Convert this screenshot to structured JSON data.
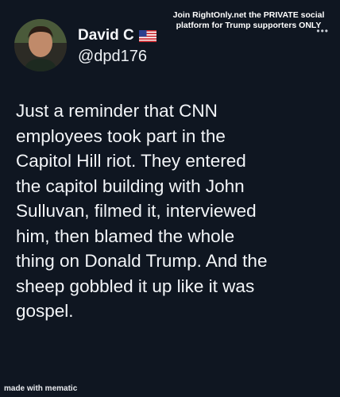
{
  "banner": {
    "line1": "Join RightOnly.net the PRIVATE social",
    "line2": "platform for Trump supporters ONLY"
  },
  "author": {
    "display_name": "David C",
    "handle": "@dpd176",
    "flag_icon": "us-flag-icon",
    "avatar_icon": "profile-photo"
  },
  "menu": {
    "more_icon": "ellipsis-icon",
    "more_glyph": "•••"
  },
  "tweet": {
    "lines": [
      "Just a reminder that CNN",
      "employees took part in the",
      "Capitol Hill riot. They entered",
      "the capitol building with John",
      "Sulluvan, filmed it, interviewed",
      "him,  then blamed the whole",
      "thing on Donald Trump. And the",
      "sheep gobbled it up like it was",
      "gospel."
    ]
  },
  "watermark": "made with mematic",
  "colors": {
    "background": "#0f1621",
    "text": "#f3f5f8"
  }
}
